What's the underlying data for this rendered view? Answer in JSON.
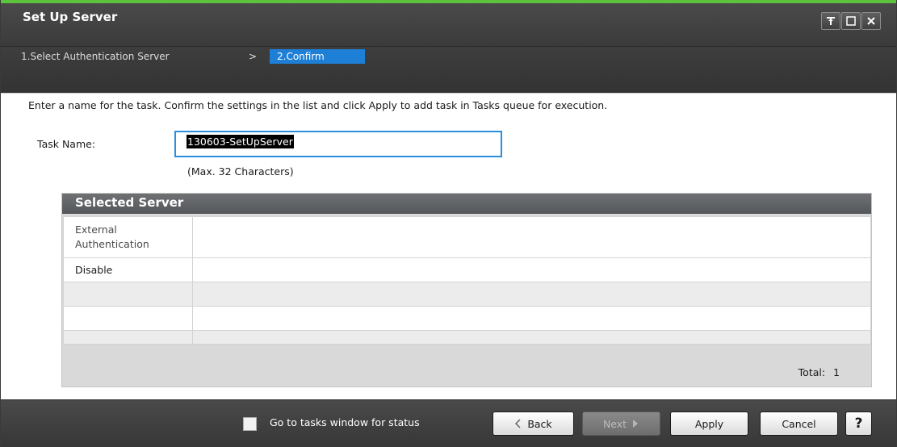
{
  "window": {
    "title": "Set Up Server"
  },
  "wizard": {
    "steps": [
      {
        "label": "1.Select Authentication Server"
      },
      {
        "label": "2.Confirm"
      }
    ],
    "separator": ">"
  },
  "instructions": "Enter a name for the task. Confirm the settings in the list and click Apply to add task in Tasks queue for execution.",
  "task": {
    "label": "Task Name:",
    "value": "130603-SetUpServer",
    "hint": "(Max. 32 Characters)"
  },
  "panel": {
    "title": "Selected Server",
    "columns": [
      "External\nAuthentication",
      ""
    ],
    "rows": [
      [
        "Disable",
        ""
      ],
      [
        "",
        ""
      ],
      [
        "",
        ""
      ],
      [
        "",
        ""
      ]
    ],
    "total_label": "Total:",
    "total_value": "1"
  },
  "footer": {
    "checkbox_label": "Go to tasks window for status",
    "back": "Back",
    "next": "Next",
    "apply": "Apply",
    "cancel": "Cancel",
    "help": "?"
  },
  "colors": {
    "accent_green": "#5cc43c",
    "active_step": "#1e7fd6",
    "input_focus": "#2b8fe0"
  }
}
